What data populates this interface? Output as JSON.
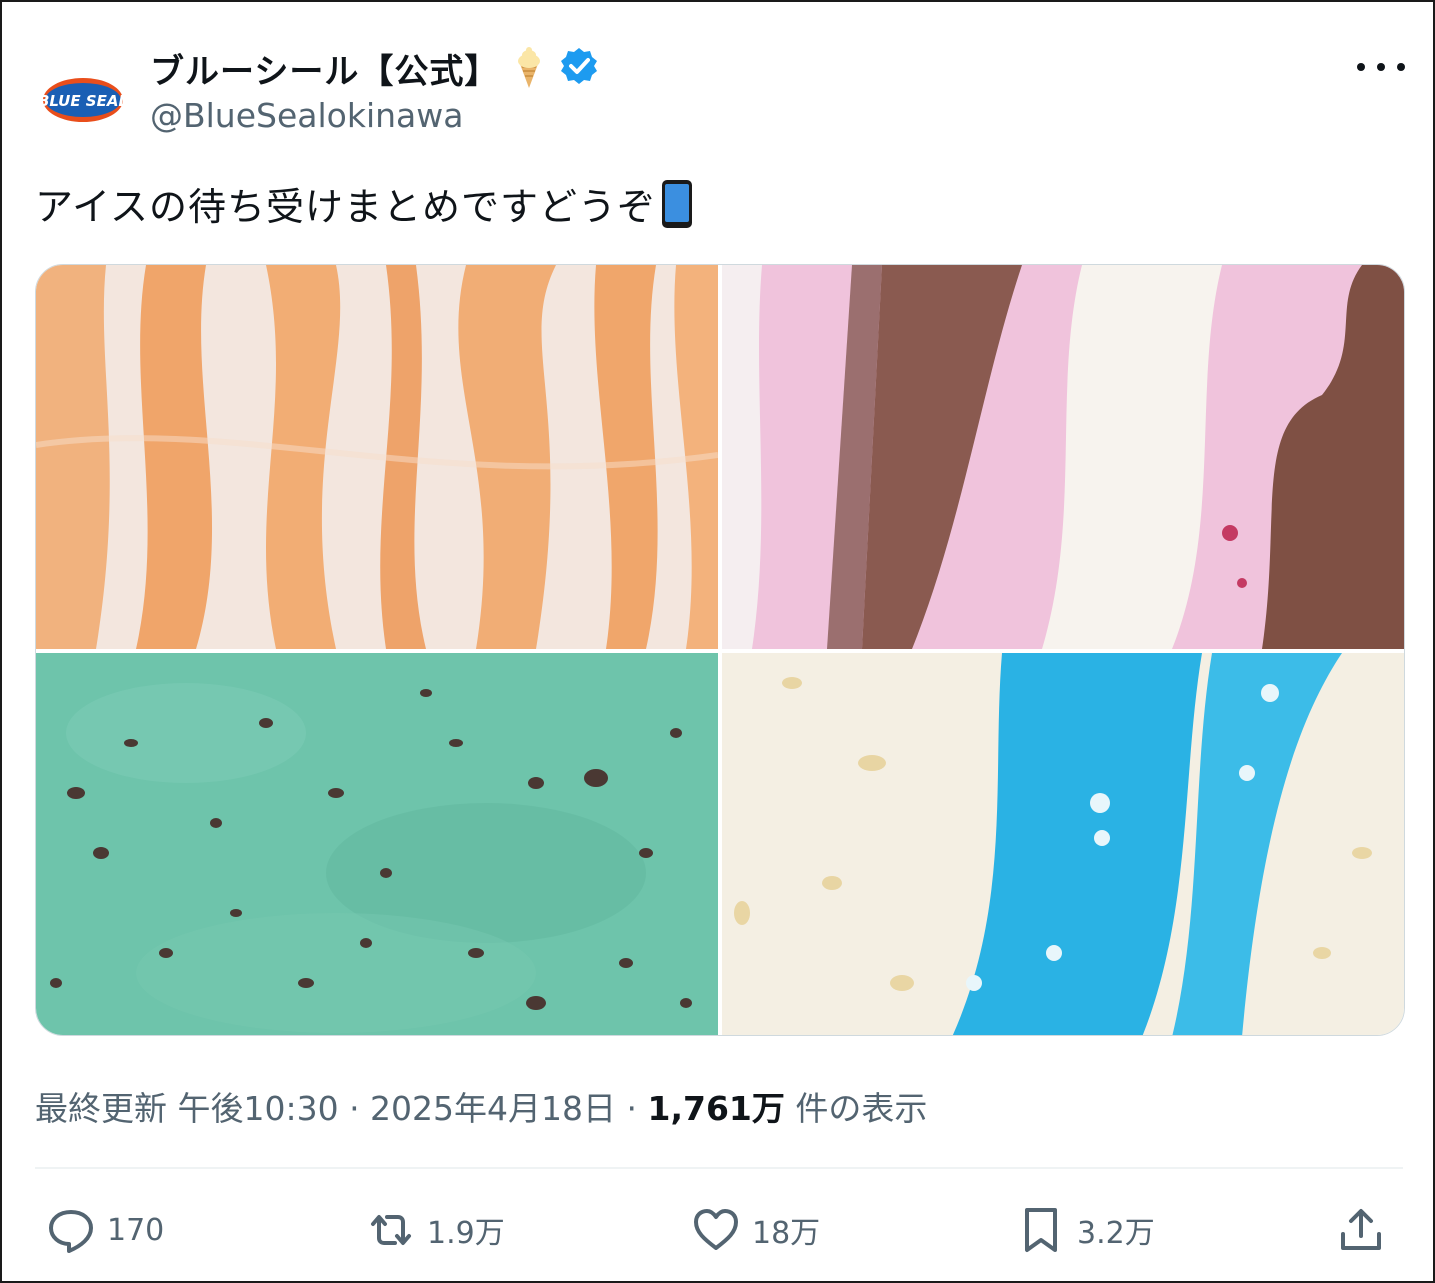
{
  "account": {
    "display_name": "ブルーシール【公式】",
    "handle": "@BlueSealokinawa",
    "avatar_text": "BLUE SEAL"
  },
  "tweet": {
    "text": "アイスの待ち受けまとめですどうぞ"
  },
  "meta": {
    "time": "最終更新 午後10:30 · 2025年4月18日 · ",
    "views_count": "1,761万",
    "views_label": " 件の表示"
  },
  "actions": {
    "replies": "170",
    "reposts": "1.9万",
    "likes": "18万",
    "bookmarks": "3.2万"
  },
  "colors": {
    "verified": "#1d9bf0",
    "text": "#0f1419",
    "muted": "#536471"
  },
  "icons": [
    "icecream-icon",
    "verified-icon",
    "phone-icon",
    "more-icon",
    "reply-icon",
    "repost-icon",
    "like-icon",
    "bookmark-icon",
    "share-icon"
  ]
}
